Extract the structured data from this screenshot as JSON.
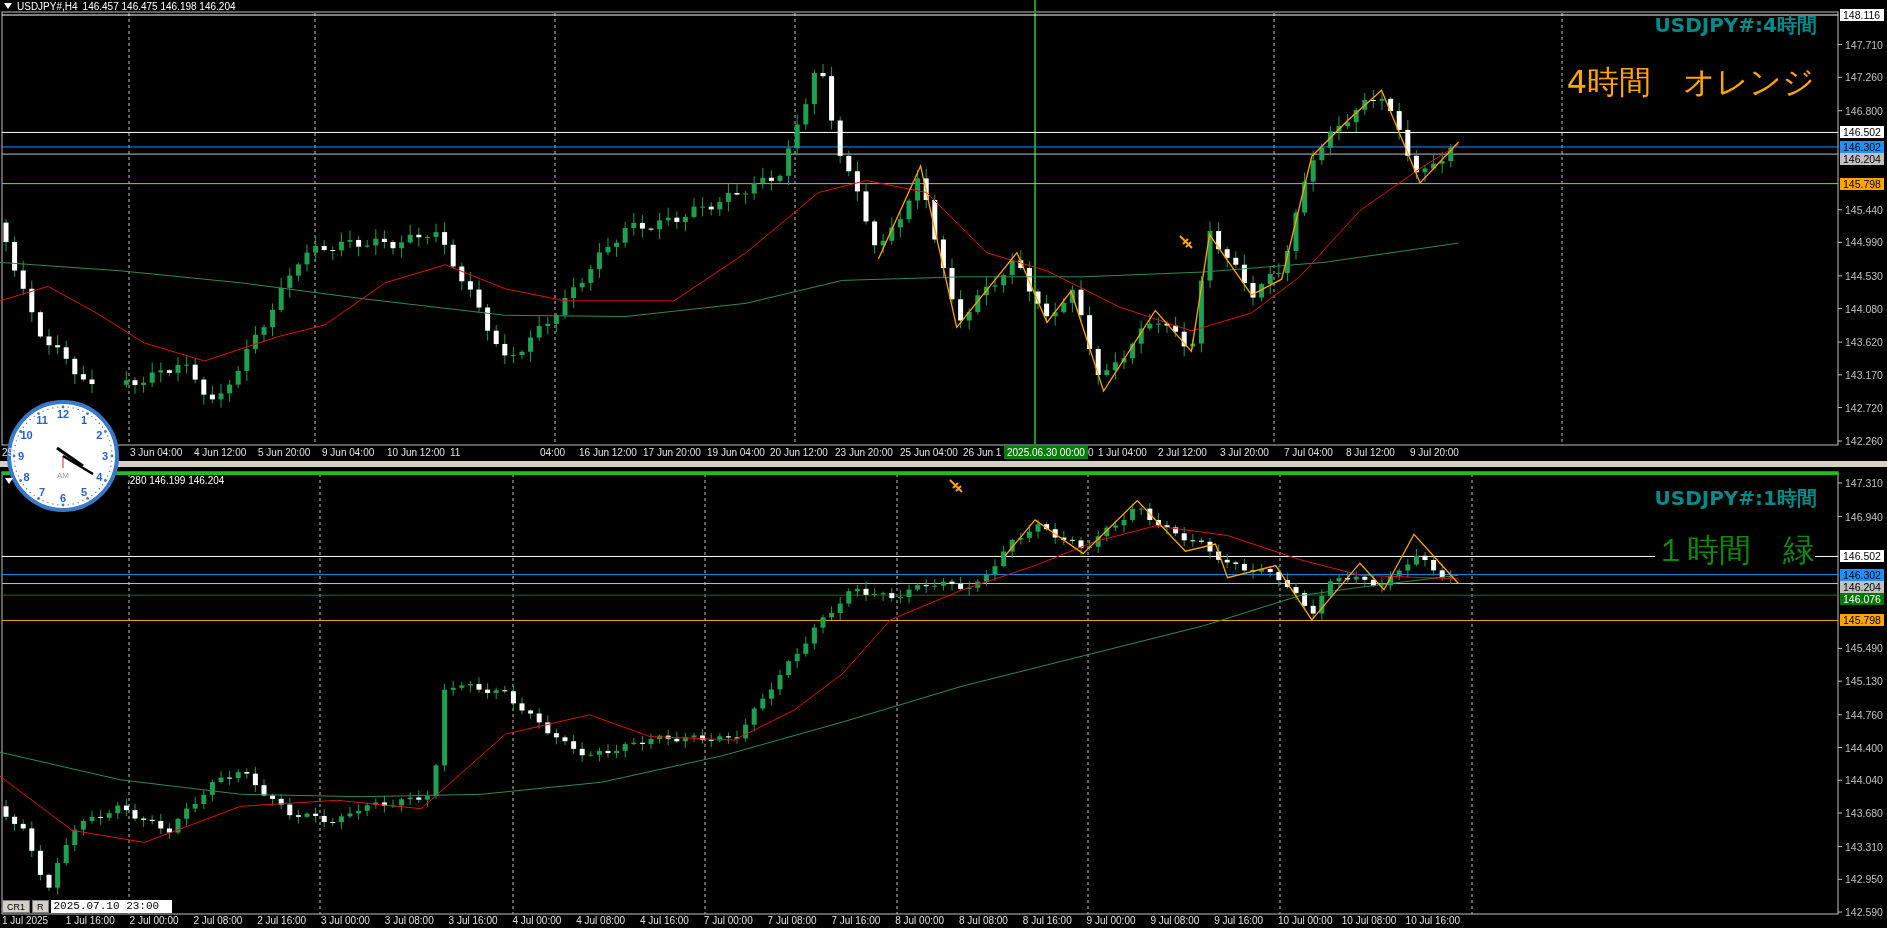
{
  "top_pane": {
    "symbol": "USDJPY#,H4",
    "quotes": "146.457 146.475 146.198 146.204",
    "title": "USDJPY#:4時間",
    "note": "4時間　オレンジ",
    "price_ticks": [
      "147.710",
      "147.260",
      "146.800",
      "145.440",
      "144.990",
      "144.530",
      "144.080",
      "143.620",
      "143.170",
      "142.720",
      "142.260"
    ],
    "price_markers": [
      {
        "value": "148.116",
        "color": "#ffffff"
      },
      {
        "value": "146.502",
        "color": "#ffffff"
      },
      {
        "value": "146.302",
        "color": "#1e90ff"
      },
      {
        "value": "146.204",
        "color": "#c0c0c0"
      },
      {
        "value": "145.798",
        "color": "#ffa500"
      }
    ],
    "time_labels": [
      "29",
      "3 Jun 04:00",
      "4 Jun 12:00",
      "5 Jun 20:00",
      "9 Jun 04:00",
      "10 Jun 12:00",
      "11",
      "04:00",
      "16 Jun 12:00",
      "17 Jun 20:00",
      "19 Jun 04:00",
      "20 Jun 12:00",
      "23 Jun 20:00",
      "25 Jun 04:00",
      "26 Jun 1",
      "0",
      "1 Jul 04:00",
      "2 Jul 12:00",
      "3 Jul 20:00",
      "7 Jul 04:00",
      "8 Jul 12:00",
      "9 Jul 20:00"
    ],
    "cursor_time": "2025.06.30 00:00"
  },
  "bottom_pane": {
    "quotes": ".280 146.199 146.204",
    "title": "USDJPY#:1時間",
    "note": "１時間　緑",
    "price_ticks": [
      "147.310",
      "146.940",
      "145.490",
      "145.130",
      "144.760",
      "144.400",
      "144.040",
      "143.680",
      "143.310",
      "142.950",
      "142.590"
    ],
    "price_markers": [
      {
        "value": "146.502",
        "color": "#ffffff"
      },
      {
        "value": "146.302",
        "color": "#1e90ff"
      },
      {
        "value": "146.204",
        "color": "#c0c0c0"
      },
      {
        "value": "146.076",
        "color": "#007800"
      },
      {
        "value": "145.798",
        "color": "#ffa500"
      }
    ],
    "time_labels": [
      "1 Jul 2025",
      "1 Jul 16:00",
      "2 Jul 00:00",
      "2 Jul 08:00",
      "2 Jul 16:00",
      "3 Jul 00:00",
      "3 Jul 08:00",
      "3 Jul 16:00",
      "4 Jul 00:00",
      "4 Jul 08:00",
      "4 Jul 16:00",
      "7 Jul 00:00",
      "7 Jul 08:00",
      "7 Jul 16:00",
      "8 Jul 00:00",
      "8 Jul 08:00",
      "8 Jul 16:00",
      "9 Jul 00:00",
      "9 Jul 08:00",
      "9 Jul 16:00",
      "10 Jul 00:00",
      "10 Jul 08:00",
      "10 Jul 16:00"
    ]
  },
  "clock": {
    "numbers": [
      "12",
      "1",
      "2",
      "3",
      "4",
      "5",
      "6",
      "7",
      "8",
      "9",
      "10",
      "11"
    ],
    "period": "AM"
  },
  "status_tabs": [
    {
      "label": "CR1"
    },
    {
      "label": "R"
    }
  ],
  "status_time": "2025.07.10 23:00"
}
